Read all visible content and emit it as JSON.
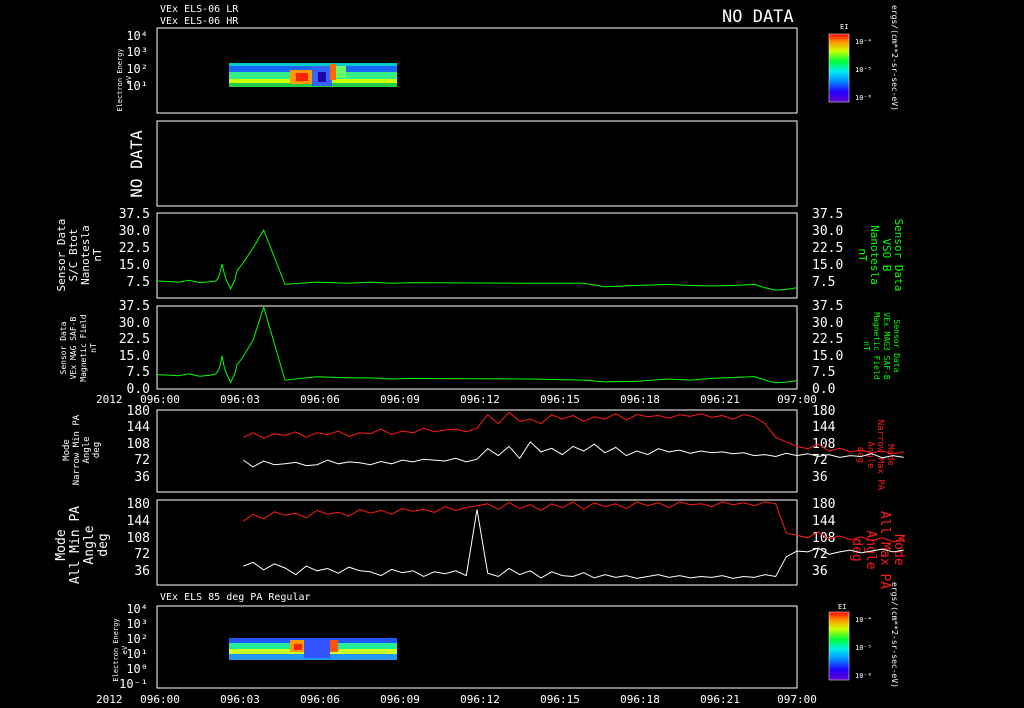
{
  "header": {
    "line1": "VEx ELS-06 LR",
    "line2": "VEx ELS-06 HR",
    "no_data": "NO DATA"
  },
  "colors": {
    "background": "#000000",
    "axes": "#ffffff",
    "green": "#00ff00",
    "red": "#ff1a1a",
    "white": "#ffffff"
  },
  "x_axis": {
    "year": "2012",
    "ticks": [
      "096:00",
      "096:03",
      "096:06",
      "096:09",
      "096:12",
      "096:15",
      "096:18",
      "096:21",
      "097:00"
    ],
    "range_minutes": [
      0,
      60
    ]
  },
  "colorbar": {
    "label": "EI",
    "ticks": [
      "10⁻⁴",
      "10⁻⁵",
      "10⁻⁶"
    ],
    "units": "ergs/(cm**2-sr-sec-eV)"
  },
  "panels": {
    "p1": {
      "ylabel_lines": [
        "Electron Energy",
        "eV"
      ],
      "ticks": [
        "10⁴",
        "10³",
        "10²",
        "10¹"
      ]
    },
    "p2": {
      "label": "NO DATA"
    },
    "p3": {
      "left_lines": [
        "Sensor Data",
        "S/C Btot",
        "Nanotesla",
        "nT"
      ],
      "right_lines": [
        "Sensor Data",
        "VSO B",
        "Nanotesla",
        "nT"
      ],
      "ticks": [
        "37.5",
        "30.0",
        "22.5",
        "15.0",
        "7.5"
      ]
    },
    "p4": {
      "left_lines": [
        "Sensor Data",
        "VEx MAG SAF-B",
        "Magnetic Field",
        "nT"
      ],
      "right_lines": [
        "Sensor Data",
        "VEx MAG3 SAF-B",
        "Magnetic Field",
        "nT"
      ],
      "ticks": [
        "37.5",
        "30.0",
        "22.5",
        "15.0",
        "7.5",
        "0.0"
      ]
    },
    "p5": {
      "left_lines": [
        "Mode",
        "Narrow Min PA",
        "Angle",
        "deg"
      ],
      "right_lines": [
        "Mode",
        "Narrow Max PA",
        "Angle",
        "deg"
      ],
      "ticks": [
        "180",
        "144",
        "108",
        "72",
        "36"
      ]
    },
    "p6": {
      "left_lines": [
        "Mode",
        "All Min PA",
        "Angle",
        "deg"
      ],
      "right_lines": [
        "Mode",
        "All Max PA",
        "Angle",
        "deg"
      ],
      "ticks": [
        "180",
        "144",
        "108",
        "72",
        "36"
      ]
    },
    "p7": {
      "title": "VEx ELS 85 deg PA Regular",
      "ylabel_lines": [
        "Electron Energy",
        "eV"
      ],
      "ticks": [
        "10⁴",
        "10³",
        "10²",
        "10¹",
        "10⁰",
        "10⁻¹"
      ]
    }
  },
  "chart_data": [
    {
      "type": "heatmap",
      "title": "VEx ELS-06 LR / VEx ELS-06 HR",
      "ylabel": "Electron Energy eV",
      "y_scale": "log",
      "ylim": [
        1,
        10000
      ],
      "data_x_range_minutes": [
        2.6,
        8.9
      ],
      "colorbar_label": "EI"
    },
    {
      "type": "line",
      "ylabel": "Sensor Data S/C Btot Nanotesla nT",
      "ylabel_right": "Sensor Data VSO B Nanotesla nT",
      "ylim": [
        0,
        37.5
      ],
      "series": [
        {
          "color": "#00ff00",
          "x": [
            0,
            1,
            2,
            3,
            4,
            5,
            5.5,
            5.7,
            5.9,
            6.1,
            6.3,
            6.5,
            6.7,
            6.9,
            7.1,
            7.3,
            7.5,
            8,
            9,
            10,
            12,
            15,
            18,
            20,
            22,
            24,
            26,
            30,
            35,
            40,
            42,
            45,
            48,
            50,
            52,
            54,
            56,
            57,
            58,
            59,
            60
          ],
          "values": [
            7.5,
            7.3,
            7.0,
            7.8,
            6.8,
            7.2,
            7.5,
            8.5,
            11,
            15,
            11,
            8,
            6,
            4,
            6,
            8,
            12,
            15,
            22,
            30,
            6,
            7,
            6.5,
            7,
            6.5,
            6.8,
            6.7,
            6.6,
            6.5,
            6.5,
            5,
            5.5,
            6,
            5.5,
            5.3,
            5.5,
            6.0,
            4.5,
            3.5,
            3.8,
            4.5
          ]
        }
      ]
    },
    {
      "type": "line",
      "ylabel": "Sensor Data VEx MAG SAF-B Magnetic Field nT",
      "ylabel_right": "Sensor Data VEx MAG3 SAF-B Magnetic Field nT",
      "ylim": [
        0,
        37.5
      ],
      "series": [
        {
          "color": "#00ff00",
          "x": [
            0,
            1,
            2,
            3,
            4,
            5,
            5.5,
            5.7,
            5.9,
            6.1,
            6.3,
            6.5,
            6.7,
            6.9,
            7.1,
            7.3,
            7.5,
            8,
            9,
            10,
            12,
            15,
            18,
            20,
            22,
            24,
            26,
            30,
            35,
            40,
            42,
            45,
            48,
            50,
            52,
            54,
            56,
            57,
            58,
            59,
            60
          ],
          "values": [
            6.5,
            6.3,
            6.0,
            6.8,
            5.8,
            6.2,
            6.8,
            8,
            10,
            15,
            10,
            7,
            5,
            3,
            5,
            7,
            11,
            14,
            22,
            37,
            4,
            5.5,
            5,
            5,
            4.5,
            4.8,
            4.7,
            4.6,
            4.5,
            4,
            3.2,
            3.5,
            4.5,
            4.0,
            4.8,
            5.2,
            5.6,
            4.0,
            2.8,
            3.1,
            3.8
          ]
        }
      ]
    },
    {
      "type": "line",
      "ylabel": "Mode Narrow Min PA Angle deg",
      "ylabel_right": "Mode Narrow Max PA Angle deg",
      "ylim": [
        0,
        180
      ],
      "series": [
        {
          "color": "#ffffff",
          "x": [
            8.1,
            9,
            10,
            11,
            12,
            13,
            14,
            15,
            16,
            17,
            18,
            19,
            20,
            21,
            22,
            23,
            24,
            25,
            26,
            27,
            28,
            29,
            30,
            31,
            32,
            33,
            34,
            35,
            36,
            37,
            38,
            39,
            40,
            41,
            42,
            43,
            44,
            45,
            46,
            47,
            48,
            49,
            50,
            51,
            52,
            53,
            54,
            55,
            56,
            57,
            58,
            59,
            60,
            61,
            62,
            63,
            64,
            65,
            66,
            67,
            68,
            69,
            70
          ],
          "values": [
            70,
            55,
            68,
            60,
            62,
            65,
            58,
            60,
            70,
            62,
            66,
            64,
            60,
            67,
            62,
            70,
            66,
            72,
            70,
            68,
            74,
            66,
            72,
            95,
            80,
            100,
            74,
            110,
            88,
            96,
            82,
            100,
            90,
            105,
            86,
            98,
            80,
            90,
            82,
            95,
            88,
            92,
            85,
            90,
            86,
            88,
            84,
            86,
            80,
            82,
            78,
            85,
            80,
            84,
            78,
            82,
            76,
            80,
            78,
            84,
            75,
            80,
            76
          ]
        },
        {
          "color": "#ff1a1a",
          "x": [
            8.1,
            9,
            10,
            11,
            12,
            13,
            14,
            15,
            16,
            17,
            18,
            19,
            20,
            21,
            22,
            23,
            24,
            25,
            26,
            27,
            28,
            29,
            30,
            31,
            32,
            33,
            34,
            35,
            36,
            37,
            38,
            39,
            40,
            41,
            42,
            43,
            44,
            45,
            46,
            47,
            48,
            49,
            50,
            51,
            52,
            53,
            54,
            55,
            56,
            57,
            58,
            59,
            60,
            61,
            62,
            63,
            64,
            65,
            66,
            67,
            68,
            69,
            70
          ],
          "values": [
            120,
            130,
            118,
            128,
            124,
            132,
            120,
            130,
            126,
            134,
            122,
            130,
            128,
            138,
            126,
            134,
            130,
            140,
            132,
            136,
            138,
            132,
            140,
            170,
            150,
            175,
            155,
            160,
            150,
            170,
            160,
            168,
            155,
            165,
            160,
            172,
            158,
            170,
            165,
            168,
            162,
            170,
            166,
            172,
            164,
            168,
            160,
            170,
            165,
            150,
            120,
            110,
            100,
            95,
            105,
            90,
            96,
            88,
            92,
            86,
            90,
            84,
            88
          ]
        }
      ]
    },
    {
      "type": "line",
      "ylabel": "Mode All Min PA Angle deg",
      "ylabel_right": "Mode All Max PA Angle deg",
      "ylim": [
        0,
        180
      ],
      "series": [
        {
          "color": "#ffffff",
          "x": [
            8.1,
            9,
            10,
            11,
            12,
            13,
            14,
            15,
            16,
            17,
            18,
            19,
            20,
            21,
            22,
            23,
            24,
            25,
            26,
            27,
            28,
            29,
            30,
            31,
            32,
            33,
            34,
            35,
            36,
            37,
            38,
            39,
            40,
            41,
            42,
            43,
            44,
            45,
            46,
            47,
            48,
            49,
            50,
            51,
            52,
            53,
            54,
            55,
            56,
            57,
            58,
            59,
            60,
            61,
            62,
            63,
            64,
            65,
            66,
            67,
            68,
            69,
            70
          ],
          "values": [
            40,
            48,
            32,
            45,
            36,
            22,
            40,
            30,
            35,
            25,
            38,
            30,
            28,
            20,
            33,
            26,
            30,
            18,
            28,
            24,
            30,
            20,
            160,
            25,
            18,
            35,
            22,
            30,
            15,
            28,
            20,
            18,
            26,
            15,
            22,
            16,
            20,
            14,
            18,
            22,
            16,
            20,
            15,
            18,
            16,
            20,
            14,
            18,
            16,
            22,
            18,
            60,
            72,
            70,
            78,
            65,
            70,
            74,
            68,
            72,
            76,
            70,
            74
          ]
        },
        {
          "color": "#ff1a1a",
          "x": [
            8.1,
            9,
            10,
            11,
            12,
            13,
            14,
            15,
            16,
            17,
            18,
            19,
            20,
            21,
            22,
            23,
            24,
            25,
            26,
            27,
            28,
            29,
            30,
            31,
            32,
            33,
            34,
            35,
            36,
            37,
            38,
            39,
            40,
            41,
            42,
            43,
            44,
            45,
            46,
            47,
            48,
            49,
            50,
            51,
            52,
            53,
            54,
            55,
            56,
            57,
            58,
            59,
            60,
            61,
            62,
            63,
            64,
            65,
            66,
            67,
            68,
            69,
            70
          ],
          "values": [
            135,
            150,
            140,
            155,
            148,
            152,
            142,
            158,
            150,
            154,
            146,
            160,
            152,
            158,
            150,
            162,
            156,
            160,
            154,
            166,
            158,
            164,
            168,
            172,
            160,
            175,
            162,
            170,
            158,
            172,
            164,
            176,
            160,
            174,
            166,
            172,
            162,
            176,
            168,
            174,
            164,
            176,
            170,
            172,
            166,
            176,
            170,
            174,
            168,
            176,
            172,
            110,
            105,
            100,
            112,
            98,
            104,
            96,
            102,
            94,
            100,
            92,
            98
          ]
        }
      ]
    },
    {
      "type": "heatmap",
      "title": "VEx ELS 85 deg PA Regular",
      "ylabel": "Electron Energy eV",
      "y_scale": "log",
      "ylim": [
        0.1,
        10000
      ],
      "data_x_range_minutes": [
        2.6,
        8.9
      ],
      "colorbar_label": "EI"
    }
  ]
}
